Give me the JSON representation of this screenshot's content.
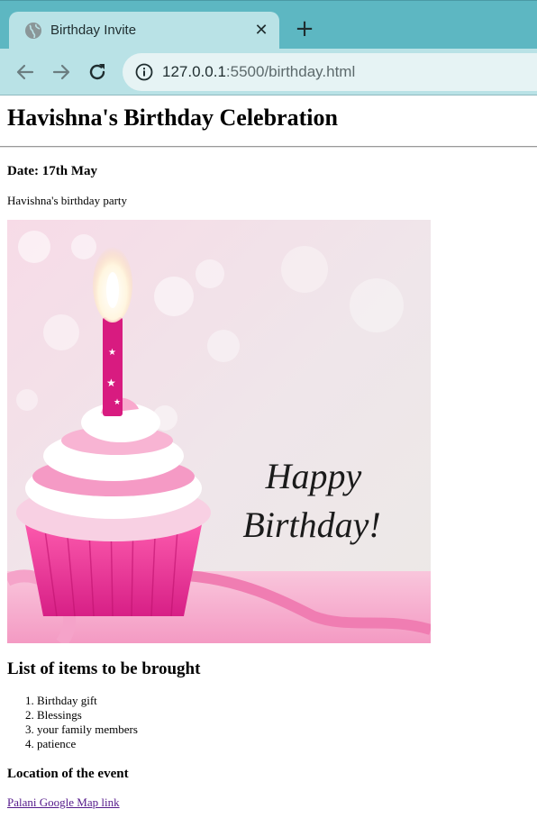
{
  "browser": {
    "tab": {
      "title": "Birthday Invite",
      "favicon": "globe-icon",
      "close": "close-icon"
    },
    "new_tab": "plus-icon",
    "nav": {
      "back": "back-arrow-icon",
      "forward": "forward-arrow-icon",
      "reload": "reload-icon"
    },
    "address": {
      "host": "127.0.0.1",
      "rest": ":5500/birthday.html",
      "security": "info-icon"
    },
    "colors": {
      "tabstrip": "#5db7c2",
      "tab": "#b9e2e6",
      "omnibox": "#e6f3f4"
    }
  },
  "page": {
    "heading": "Havishna's Birthday Celebration",
    "date": "Date: 17th May",
    "description": "Havishna's birthday party",
    "image": {
      "caption_line1": "Happy",
      "caption_line2": "Birthday!"
    },
    "items_heading": "List of items to be brought",
    "items": [
      "Birthday gift",
      "Blessings",
      "your family members",
      "patience"
    ],
    "location_heading": "Location of the event",
    "map_link": "Palani Google Map link",
    "colors": {
      "link_visited": "#551a8b"
    }
  }
}
